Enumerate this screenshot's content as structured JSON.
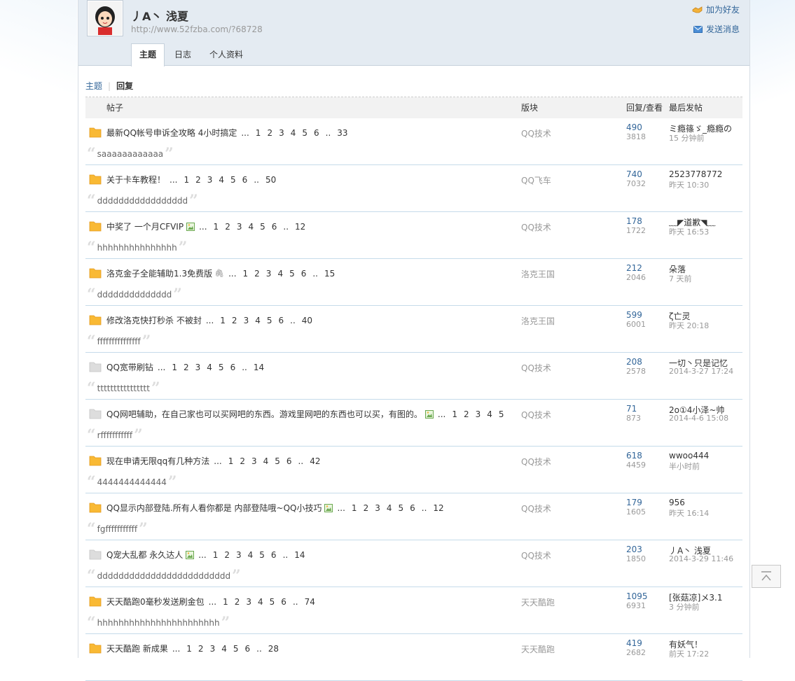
{
  "profile": {
    "username": "丿A丶 浅夏",
    "url": "http://www.52fzba.com/?68728",
    "add_friend": "加为好友",
    "send_message": "发送消息"
  },
  "tabs": [
    {
      "label": "主题",
      "active": true
    },
    {
      "label": "日志",
      "active": false
    },
    {
      "label": "个人资料",
      "active": false
    }
  ],
  "subnav": {
    "topics": "主题",
    "separator": "|",
    "replies": "回复"
  },
  "table": {
    "headers": {
      "post": "帖子",
      "forum": "版块",
      "replies_views": "回复/查看",
      "last_post": "最后发帖"
    },
    "rows": [
      {
        "title": "最新QQ帐号申诉全攻略 4小时搞定",
        "pages": [
          "1",
          "2",
          "3",
          "4",
          "5",
          "6"
        ],
        "last_page": "33",
        "has_image": false,
        "has_attach": false,
        "icon": "folder-hot",
        "forum": "QQ技术",
        "replies": "490",
        "views": "3818",
        "last_user": "ミ瘾篠ゞ_瘾瘾の",
        "last_time": "15 分钟前",
        "quote": "saaaaaaaaaaaa"
      },
      {
        "title": "关于卡车教程！",
        "pages": [
          "1",
          "2",
          "3",
          "4",
          "5",
          "6"
        ],
        "last_page": "50",
        "has_image": false,
        "has_attach": false,
        "icon": "folder-hot",
        "forum": "QQ飞车",
        "replies": "740",
        "views": "7032",
        "last_user": "2523778772",
        "last_time": "昨天 10:30",
        "quote": "ddddddddddddddddd"
      },
      {
        "title": "中奖了 一个月CFVIP",
        "pages": [
          "1",
          "2",
          "3",
          "4",
          "5",
          "6"
        ],
        "last_page": "12",
        "has_image": true,
        "has_attach": false,
        "icon": "folder-hot",
        "forum": "QQ技术",
        "replies": "178",
        "views": "1722",
        "last_user": "﹏◤道歉◥﹏",
        "last_time": "昨天 16:53",
        "quote": "hhhhhhhhhhhhhhh"
      },
      {
        "title": "洛克金子全能辅助1.3免费版",
        "pages": [
          "1",
          "2",
          "3",
          "4",
          "5",
          "6"
        ],
        "last_page": "15",
        "has_image": false,
        "has_attach": true,
        "icon": "folder-hot",
        "forum": "洛克王国",
        "replies": "212",
        "views": "2046",
        "last_user": "朵落",
        "last_time": "7 天前",
        "quote": "dddddddddddddd"
      },
      {
        "title": "修改洛克快打秒杀 不被封",
        "pages": [
          "1",
          "2",
          "3",
          "4",
          "5",
          "6"
        ],
        "last_page": "40",
        "has_image": false,
        "has_attach": false,
        "icon": "folder-hot",
        "forum": "洛克王国",
        "replies": "599",
        "views": "6001",
        "last_user": "ζ亡灵",
        "last_time": "昨天 20:18",
        "quote": "fffffffffffffff"
      },
      {
        "title": "QQ宽带刷钻",
        "pages": [
          "1",
          "2",
          "3",
          "4",
          "5",
          "6"
        ],
        "last_page": "14",
        "has_image": false,
        "has_attach": false,
        "icon": "folder-normal",
        "forum": "QQ技术",
        "replies": "208",
        "views": "2578",
        "last_user": "一切丶只是记忆",
        "last_time": "2014-3-27 17:24",
        "quote": "tttttttttttttttt"
      },
      {
        "title": "QQ网吧辅助，在自己家也可以买网吧的东西。游戏里网吧的东西也可以买，有图的。",
        "pages": [
          "1",
          "2",
          "3",
          "4",
          "5"
        ],
        "last_page": "",
        "has_image": true,
        "has_attach": false,
        "icon": "folder-normal",
        "forum": "QQ技术",
        "replies": "71",
        "views": "873",
        "last_user": "2o①4小泽~帅",
        "last_time": "2014-4-6 15:08",
        "quote": "rfffffffffff"
      },
      {
        "title": "现在申请无限qq有几种方法",
        "pages": [
          "1",
          "2",
          "3",
          "4",
          "5",
          "6"
        ],
        "last_page": "42",
        "has_image": false,
        "has_attach": false,
        "icon": "folder-hot",
        "forum": "QQ技术",
        "replies": "618",
        "views": "4459",
        "last_user": "wwoo444",
        "last_time": "半小时前",
        "quote": "4444444444444"
      },
      {
        "title": "QQ显示内部登陆.所有人看你都是 内部登陆哦~QQ小技巧",
        "pages": [
          "1",
          "2",
          "3",
          "4",
          "5",
          "6"
        ],
        "last_page": "12",
        "has_image": true,
        "has_attach": false,
        "icon": "folder-hot",
        "forum": "QQ技术",
        "replies": "179",
        "views": "1605",
        "last_user": "956",
        "last_time": "昨天 16:14",
        "quote": "fgfffffffffff"
      },
      {
        "title": "Q宠大乱都 永久达人",
        "pages": [
          "1",
          "2",
          "3",
          "4",
          "5",
          "6"
        ],
        "last_page": "14",
        "has_image": true,
        "has_attach": false,
        "icon": "folder-normal",
        "forum": "QQ技术",
        "replies": "203",
        "views": "1850",
        "last_user": "丿A丶 浅夏",
        "last_time": "2014-3-29 11:46",
        "quote": "ddddddddddddddddddddddddd"
      },
      {
        "title": "天天酷跑0毫秒发送刷金包",
        "pages": [
          "1",
          "2",
          "3",
          "4",
          "5",
          "6"
        ],
        "last_page": "74",
        "has_image": false,
        "has_attach": false,
        "icon": "folder-hot",
        "forum": "天天酷跑",
        "replies": "1095",
        "views": "6931",
        "last_user": "[张菇凉]メ3.1",
        "last_time": "3 分钟前",
        "quote": "hhhhhhhhhhhhhhhhhhhhhhh"
      },
      {
        "title": "天天酷跑 新成果",
        "pages": [
          "1",
          "2",
          "3",
          "4",
          "5",
          "6"
        ],
        "last_page": "28",
        "has_image": false,
        "has_attach": false,
        "icon": "folder-hot",
        "forum": "天天酷跑",
        "replies": "419",
        "views": "2682",
        "last_user": "有妖气！",
        "last_time": "前天 17:22",
        "quote": ""
      }
    ]
  },
  "colors": {
    "link": "#336699",
    "header_bg": "#e4ebf2",
    "folder_hot": "#f9b934",
    "folder_normal": "#dddddd"
  }
}
